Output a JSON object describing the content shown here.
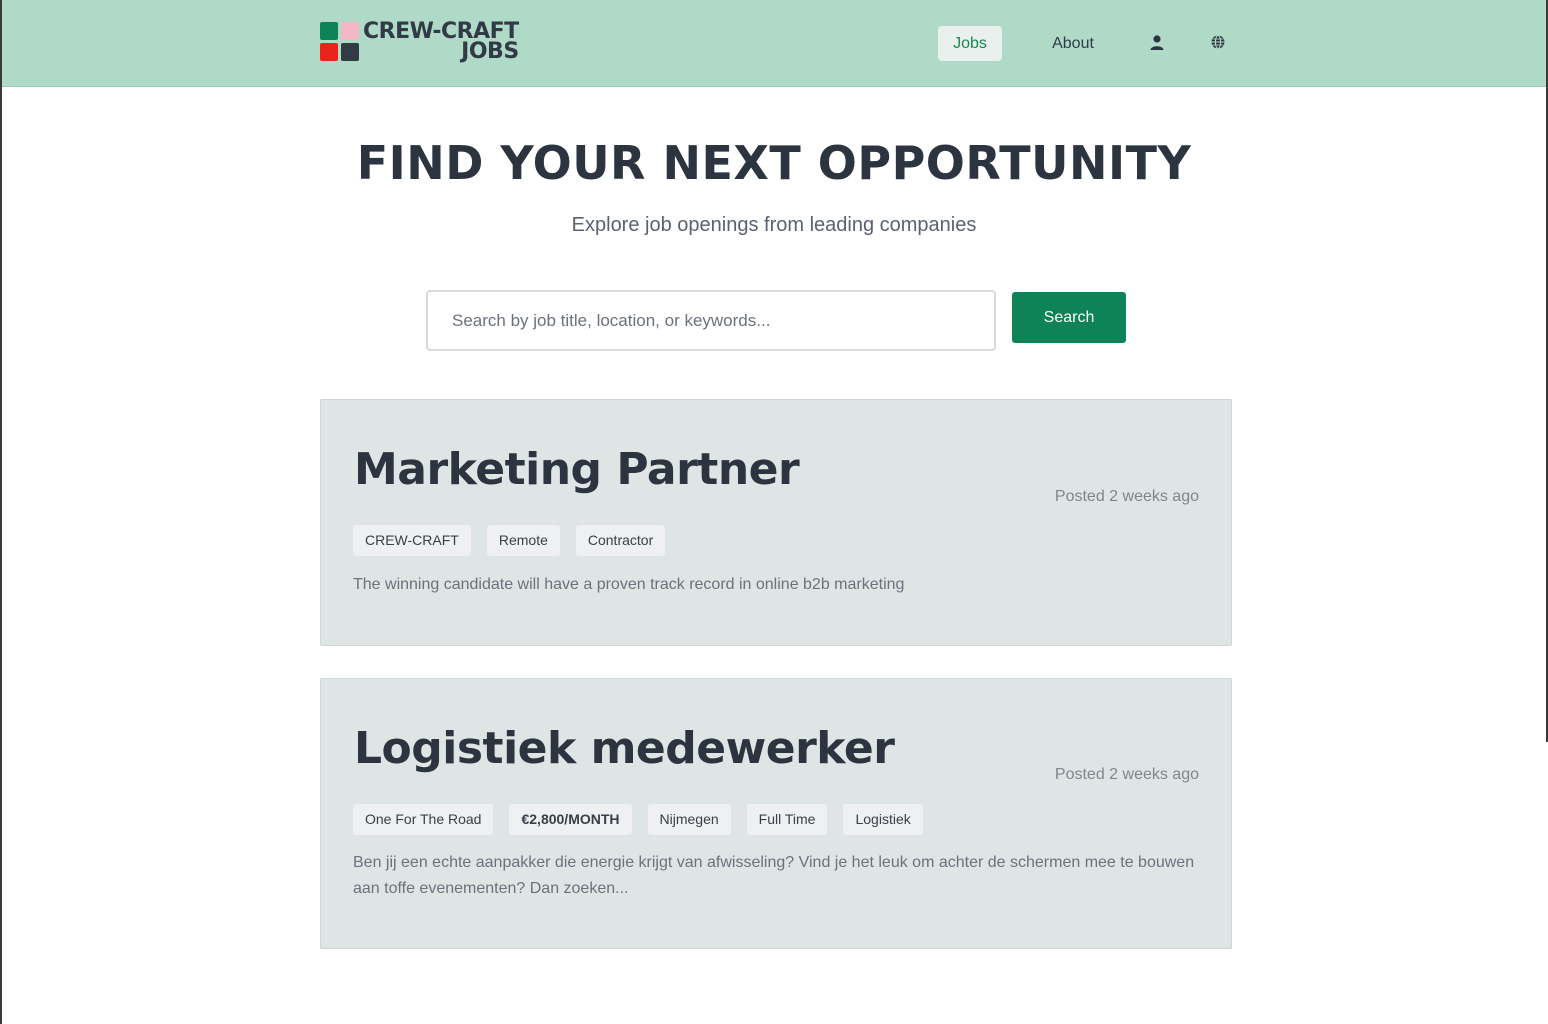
{
  "header": {
    "logo": {
      "line1": "CREW-CRAFT",
      "line2": "JOBS",
      "colors": [
        "#0f8358",
        "#f2b8c6",
        "#e8241b",
        "#323a46"
      ]
    },
    "nav": {
      "jobs_label": "Jobs",
      "about_label": "About",
      "user_icon": "user-icon",
      "globe_icon": "globe-icon"
    },
    "bg_color": "#afdac8"
  },
  "hero": {
    "title": "FIND YOUR NEXT OPPORTUNITY",
    "subtitle": "Explore job openings from leading companies"
  },
  "search": {
    "placeholder": "Search by job title, location, or keywords...",
    "value": "",
    "button_label": "Search",
    "accent": "#0f8358"
  },
  "jobs": [
    {
      "title": "Marketing Partner",
      "posted": "Posted 2 weeks ago",
      "tags": [
        "CREW-CRAFT",
        "Remote",
        "Contractor"
      ],
      "description": "The winning candidate will have a proven track record in online b2b marketing"
    },
    {
      "title": "Logistiek medewerker",
      "posted": "Posted 2 weeks ago",
      "tags": [
        "One For The Road",
        "€2,800/MONTH",
        "Nijmegen",
        "Full Time",
        "Logistiek"
      ],
      "description": "Ben jij een echte aanpakker die energie krijgt van afwisseling? Vind je het leuk om achter de schermen mee te bouwen aan toffe evenementen? Dan zoeken..."
    }
  ]
}
